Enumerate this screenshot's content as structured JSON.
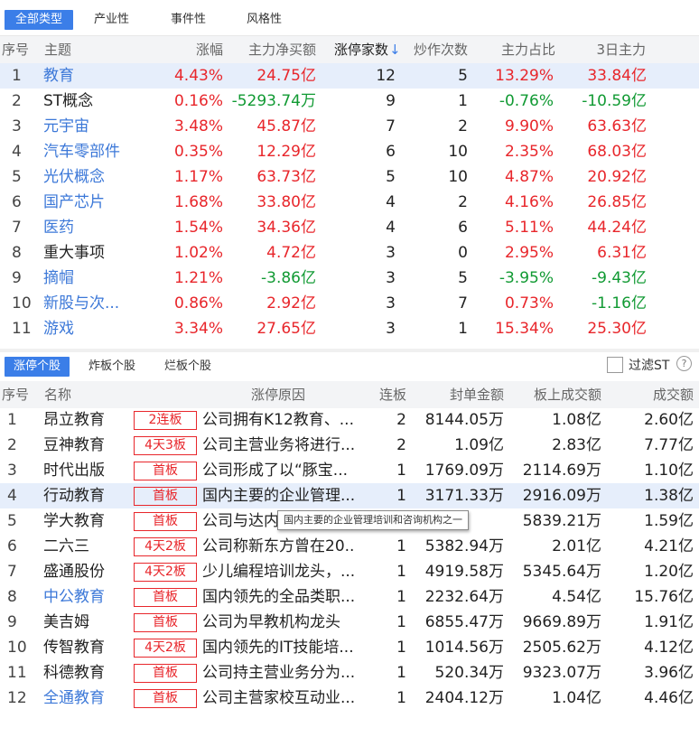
{
  "top_tabs": [
    "全部类型",
    "产业性",
    "事件性",
    "风格性"
  ],
  "top_table": {
    "headers": [
      "序号",
      "主题",
      "涨幅",
      "主力净买额",
      "涨停家数",
      "炒作次数",
      "主力占比",
      "3日主力"
    ],
    "sort_arrow": "↓",
    "rows": [
      {
        "no": "1",
        "theme": "教育",
        "change": "4.43%",
        "net_buy": "24.75亿",
        "limit_up": "12",
        "hype": "5",
        "ratio": "13.29%",
        "three_day": "33.84亿"
      },
      {
        "no": "2",
        "theme": "ST概念",
        "change": "0.16%",
        "net_buy": "-5293.74万",
        "limit_up": "9",
        "hype": "1",
        "ratio": "-0.76%",
        "three_day": "-10.59亿"
      },
      {
        "no": "3",
        "theme": "元宇宙",
        "change": "3.48%",
        "net_buy": "45.87亿",
        "limit_up": "7",
        "hype": "2",
        "ratio": "9.90%",
        "three_day": "63.63亿"
      },
      {
        "no": "4",
        "theme": "汽车零部件",
        "change": "0.35%",
        "net_buy": "12.29亿",
        "limit_up": "6",
        "hype": "10",
        "ratio": "2.35%",
        "three_day": "68.03亿"
      },
      {
        "no": "5",
        "theme": "光伏概念",
        "change": "1.17%",
        "net_buy": "63.73亿",
        "limit_up": "5",
        "hype": "10",
        "ratio": "4.87%",
        "three_day": "20.92亿"
      },
      {
        "no": "6",
        "theme": "国产芯片",
        "change": "1.68%",
        "net_buy": "33.80亿",
        "limit_up": "4",
        "hype": "2",
        "ratio": "4.16%",
        "three_day": "26.85亿"
      },
      {
        "no": "7",
        "theme": "医药",
        "change": "1.54%",
        "net_buy": "34.36亿",
        "limit_up": "4",
        "hype": "6",
        "ratio": "5.11%",
        "three_day": "44.24亿"
      },
      {
        "no": "8",
        "theme": "重大事项",
        "change": "1.02%",
        "net_buy": "4.72亿",
        "limit_up": "3",
        "hype": "0",
        "ratio": "2.95%",
        "three_day": "6.31亿"
      },
      {
        "no": "9",
        "theme": "摘帽",
        "change": "1.21%",
        "net_buy": "-3.86亿",
        "limit_up": "3",
        "hype": "5",
        "ratio": "-3.95%",
        "three_day": "-9.43亿"
      },
      {
        "no": "10",
        "theme": "新股与次...",
        "change": "0.86%",
        "net_buy": "2.92亿",
        "limit_up": "3",
        "hype": "7",
        "ratio": "0.73%",
        "three_day": "-1.16亿"
      },
      {
        "no": "11",
        "theme": "游戏",
        "change": "3.34%",
        "net_buy": "27.65亿",
        "limit_up": "3",
        "hype": "1",
        "ratio": "15.34%",
        "three_day": "25.30亿"
      }
    ]
  },
  "sub_tabs": [
    "涨停个股",
    "炸板个股",
    "烂板个股"
  ],
  "filter_st_label": "过滤ST",
  "help_glyph": "?",
  "bottom_table": {
    "headers": [
      "序号",
      "名称",
      "涨停原因",
      "连板",
      "封单金额",
      "板上成交额",
      "成交额"
    ],
    "rows": [
      {
        "no": "1",
        "name": "昂立教育",
        "badge": "2连板",
        "reason": "公司拥有K12教育、...",
        "boards": "2",
        "seal": "8144.05万",
        "on_board": "1.08亿",
        "turnover": "2.60亿"
      },
      {
        "no": "2",
        "name": "豆神教育",
        "badge": "4天3板",
        "reason": "公司主营业务将进行...",
        "boards": "2",
        "seal": "1.09亿",
        "on_board": "2.83亿",
        "turnover": "7.77亿"
      },
      {
        "no": "3",
        "name": "时代出版",
        "badge": "首板",
        "reason": "公司形成了以“豚宝...",
        "boards": "1",
        "seal": "1769.09万",
        "on_board": "2114.69万",
        "turnover": "1.10亿"
      },
      {
        "no": "4",
        "name": "行动教育",
        "badge": "首板",
        "reason": "国内主要的企业管理...",
        "boards": "1",
        "seal": "3171.33万",
        "on_board": "2916.09万",
        "turnover": "1.38亿"
      },
      {
        "no": "5",
        "name": "学大教育",
        "badge": "首板",
        "reason": "公司与达内",
        "boards": "1",
        "seal": "",
        "on_board": "5839.21万",
        "turnover": "1.59亿"
      },
      {
        "no": "6",
        "name": "二六三",
        "badge": "4天2板",
        "reason": "公司称新东方曾在20...",
        "boards": "1",
        "seal": "5382.94万",
        "on_board": "2.01亿",
        "turnover": "4.21亿"
      },
      {
        "no": "7",
        "name": "盛通股份",
        "badge": "4天2板",
        "reason": "少儿编程培训龙头，...",
        "boards": "1",
        "seal": "4919.58万",
        "on_board": "5345.64万",
        "turnover": "1.20亿"
      },
      {
        "no": "8",
        "name": "中公教育",
        "badge": "首板",
        "reason": "国内领先的全品类职...",
        "boards": "1",
        "seal": "2232.64万",
        "on_board": "4.54亿",
        "turnover": "15.76亿"
      },
      {
        "no": "9",
        "name": "美吉姆",
        "badge": "首板",
        "reason": "公司为早教机构龙头",
        "boards": "1",
        "seal": "6855.47万",
        "on_board": "9669.89万",
        "turnover": "1.91亿"
      },
      {
        "no": "10",
        "name": "传智教育",
        "badge": "4天2板",
        "reason": "国内领先的IT技能培...",
        "boards": "1",
        "seal": "1014.56万",
        "on_board": "2505.62万",
        "turnover": "4.12亿"
      },
      {
        "no": "11",
        "name": "科德教育",
        "badge": "首板",
        "reason": "公司持主营业务分为...",
        "boards": "1",
        "seal": "520.34万",
        "on_board": "9323.07万",
        "turnover": "3.96亿"
      },
      {
        "no": "12",
        "name": "全通教育",
        "badge": "首板",
        "reason": "公司主营家校互动业...",
        "boards": "1",
        "seal": "2404.12万",
        "on_board": "1.04亿",
        "turnover": "4.46亿"
      }
    ]
  },
  "tooltip": "国内主要的企业管理培训和咨询机构之一",
  "colors": {
    "up": "#e8262b",
    "down": "#119a33",
    "link": "#3c78d8",
    "accent": "#3b7ee8",
    "selected_row": "#e6eefb"
  },
  "styles": {
    "top_theme": [
      "blue",
      "black",
      "blue",
      "blue",
      "blue",
      "blue",
      "blue",
      "black",
      "blue",
      "blue",
      "blue"
    ],
    "top_net_buy": [
      "red",
      "green",
      "red",
      "red",
      "red",
      "red",
      "red",
      "red",
      "green",
      "red",
      "red"
    ],
    "top_ratio": [
      "red",
      "green",
      "red",
      "red",
      "red",
      "red",
      "red",
      "red",
      "green",
      "red",
      "red"
    ],
    "top_three_day": [
      "red",
      "green",
      "red",
      "red",
      "red",
      "red",
      "red",
      "red",
      "green",
      "green",
      "red"
    ],
    "bottom_name": [
      "black",
      "black",
      "black",
      "black",
      "black",
      "black",
      "black",
      "blue",
      "black",
      "black",
      "black",
      "blue"
    ],
    "selected_top_row": 0,
    "selected_bottom_row": 3
  }
}
